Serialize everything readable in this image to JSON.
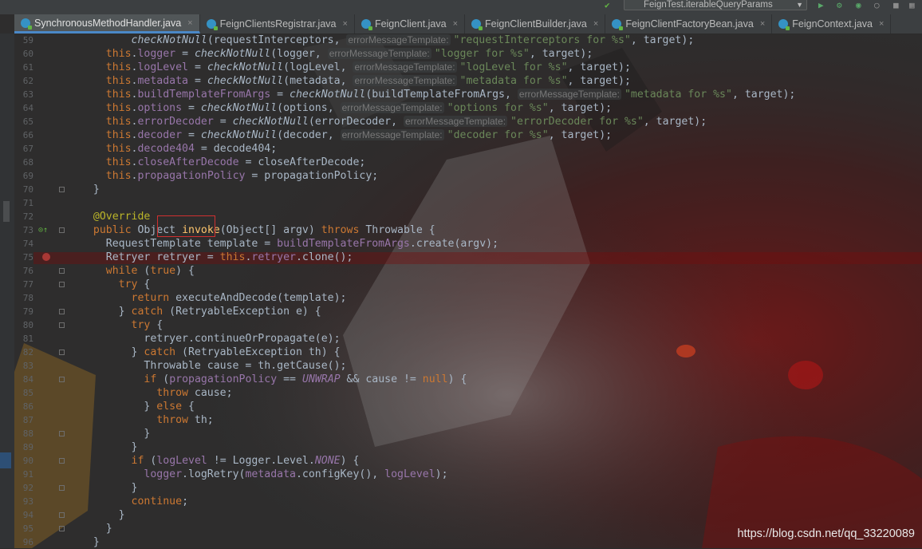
{
  "run_config": {
    "label": "FeignTest.iterableQueryParams"
  },
  "tabs": [
    {
      "label": "SynchronousMethodHandler.java",
      "active": true
    },
    {
      "label": "FeignClientsRegistrar.java",
      "active": false
    },
    {
      "label": "FeignClient.java",
      "active": false
    },
    {
      "label": "FeignClientBuilder.java",
      "active": false
    },
    {
      "label": "FeignClientFactoryBean.java",
      "active": false
    },
    {
      "label": "FeignContext.java",
      "active": false
    }
  ],
  "colors": {
    "keyword": "#cc7832",
    "field": "#9876aa",
    "string": "#6a8759",
    "annotation": "#bbb529",
    "highlight_box": "#d03030",
    "breakpoint": "#c75450"
  },
  "gutter_icons": {
    "override": "override-method-icon",
    "breakpoint": "breakpoint-icon"
  },
  "lines": [
    {
      "n": "59",
      "html": "        <span class=\"it\">checkNotNull</span>(requestInterceptors, <span class=\"hint\">errorMessageTemplate:</span><span class=\"str\">\"requestInterceptors for %s\"</span>, target);"
    },
    {
      "n": "60",
      "html": "    <span class=\"kw\">this</span>.<span class=\"fld\">logger</span> = <span class=\"it\">checkNotNull</span>(logger, <span class=\"hint\">errorMessageTemplate:</span><span class=\"str\">\"logger for %s\"</span>, target);"
    },
    {
      "n": "61",
      "html": "    <span class=\"kw\">this</span>.<span class=\"fld\">logLevel</span> = <span class=\"it\">checkNotNull</span>(logLevel, <span class=\"hint\">errorMessageTemplate:</span><span class=\"str\">\"logLevel for %s\"</span>, target);"
    },
    {
      "n": "62",
      "html": "    <span class=\"kw\">this</span>.<span class=\"fld\">metadata</span> = <span class=\"it\">checkNotNull</span>(metadata, <span class=\"hint\">errorMessageTemplate:</span><span class=\"str\">\"metadata for %s\"</span>, target);"
    },
    {
      "n": "63",
      "html": "    <span class=\"kw\">this</span>.<span class=\"fld\">buildTemplateFromArgs</span> = <span class=\"it\">checkNotNull</span>(buildTemplateFromArgs, <span class=\"hint\">errorMessageTemplate:</span><span class=\"str\">\"metadata for %s\"</span>, target);"
    },
    {
      "n": "64",
      "html": "    <span class=\"kw\">this</span>.<span class=\"fld\">options</span> = <span class=\"it\">checkNotNull</span>(options, <span class=\"hint\">errorMessageTemplate:</span><span class=\"str\">\"options for %s\"</span>, target);"
    },
    {
      "n": "65",
      "html": "    <span class=\"kw\">this</span>.<span class=\"fld\">errorDecoder</span> = <span class=\"it\">checkNotNull</span>(errorDecoder, <span class=\"hint\">errorMessageTemplate:</span><span class=\"str\">\"errorDecoder for %s\"</span>, target);"
    },
    {
      "n": "66",
      "html": "    <span class=\"kw\">this</span>.<span class=\"fld\">decoder</span> = <span class=\"it\">checkNotNull</span>(decoder, <span class=\"hint\">errorMessageTemplate:</span><span class=\"str\">\"decoder for %s\"</span>, target);"
    },
    {
      "n": "67",
      "html": "    <span class=\"kw\">this</span>.<span class=\"fld\">decode404</span> = decode404;"
    },
    {
      "n": "68",
      "html": "    <span class=\"kw\">this</span>.<span class=\"fld\">closeAfterDecode</span> = closeAfterDecode;"
    },
    {
      "n": "69",
      "html": "    <span class=\"kw\">this</span>.<span class=\"fld\">propagationPolicy</span> = propagationPolicy;"
    },
    {
      "n": "70",
      "html": "  }"
    },
    {
      "n": "71",
      "html": ""
    },
    {
      "n": "72",
      "html": "  <span class=\"ann\">@Override</span>"
    },
    {
      "n": "73",
      "html": "  <span class=\"kw\">public</span> Object <span class=\"fn\">invoke</span>(Object[] argv) <span class=\"kw\">throws</span> Throwable {"
    },
    {
      "n": "74",
      "html": "    RequestTemplate template = <span class=\"fld\">buildTemplateFromArgs</span>.create(argv);"
    },
    {
      "n": "75",
      "html": "    Retryer retryer = <span class=\"kw\">this</span>.<span class=\"fld\">retryer</span>.clone();"
    },
    {
      "n": "76",
      "html": "    <span class=\"kw\">while</span> (<span class=\"kw\">true</span>) {"
    },
    {
      "n": "77",
      "html": "      <span class=\"kw\">try</span> {"
    },
    {
      "n": "78",
      "html": "        <span class=\"kw\">return</span> executeAndDecode(template);"
    },
    {
      "n": "79",
      "html": "      } <span class=\"kw\">catch</span> (RetryableException e) {"
    },
    {
      "n": "80",
      "html": "        <span class=\"kw\">try</span> {"
    },
    {
      "n": "81",
      "html": "          retryer.continueOrPropagate(e);"
    },
    {
      "n": "82",
      "html": "        } <span class=\"kw\">catch</span> (RetryableException th) {"
    },
    {
      "n": "83",
      "html": "          Throwable cause = th.getCause();"
    },
    {
      "n": "84",
      "html": "          <span class=\"kw\">if</span> (<span class=\"fld\">propagationPolicy</span> == <span class=\"fld it\">UNWRAP</span> &amp;&amp; cause != <span class=\"kw\">null</span>) {"
    },
    {
      "n": "85",
      "html": "            <span class=\"kw\">throw</span> cause;"
    },
    {
      "n": "86",
      "html": "          } <span class=\"kw\">else</span> {"
    },
    {
      "n": "87",
      "html": "            <span class=\"kw\">throw</span> th;"
    },
    {
      "n": "88",
      "html": "          }"
    },
    {
      "n": "89",
      "html": "        }"
    },
    {
      "n": "90",
      "html": "        <span class=\"kw\">if</span> (<span class=\"fld\">logLevel</span> != Logger.Level.<span class=\"fld it\">NONE</span>) {"
    },
    {
      "n": "91",
      "html": "          <span class=\"fld\">logger</span>.logRetry(<span class=\"fld\">metadata</span>.configKey(), <span class=\"fld\">logLevel</span>);"
    },
    {
      "n": "92",
      "html": "        }"
    },
    {
      "n": "93",
      "html": "        <span class=\"kw\">continue</span>;"
    },
    {
      "n": "94",
      "html": "      }"
    },
    {
      "n": "95",
      "html": "    }"
    },
    {
      "n": "96",
      "html": "  }"
    }
  ],
  "watermark": "https://blog.csdn.net/qq_33220089"
}
